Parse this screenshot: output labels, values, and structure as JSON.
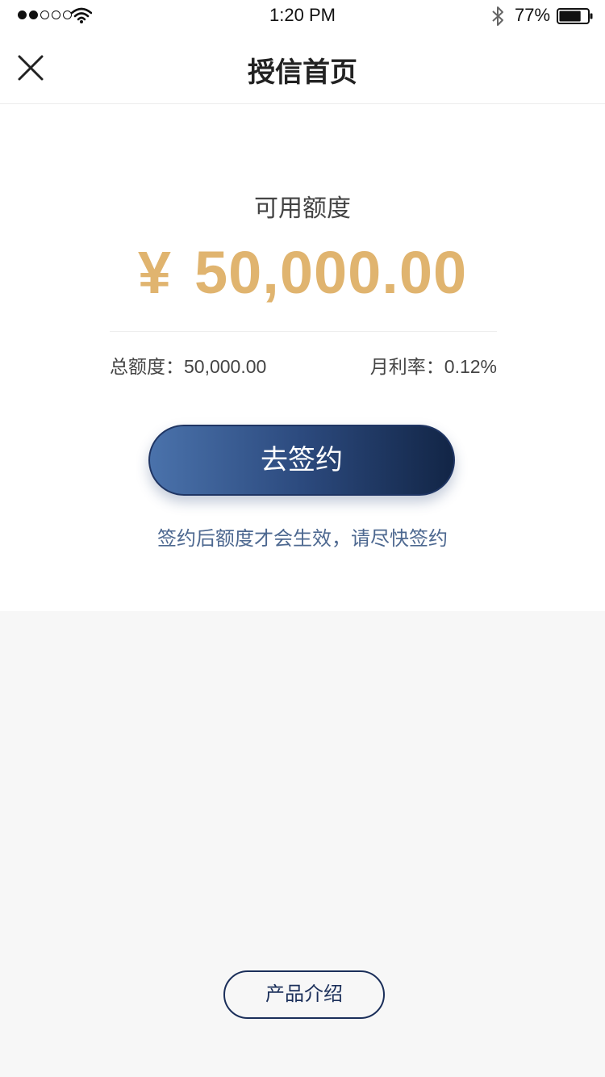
{
  "status_bar": {
    "time": "1:20 PM",
    "battery_percent": "77%",
    "battery_level": 0.77,
    "signal_strength": 2,
    "signal_total": 5
  },
  "nav": {
    "title": "授信首页",
    "close_icon": "close-icon"
  },
  "credit": {
    "available_label": "可用额度",
    "currency_symbol": "¥",
    "available_amount": "50,000.00",
    "total_label": "总额度：",
    "total_value": "50,000.00",
    "rate_label": "月利率：",
    "rate_value": "0.12%",
    "accent_color": "#e0b46f"
  },
  "actions": {
    "sign_label": "去签约",
    "sign_hint": "签约后额度才会生效，请尽快签约",
    "intro_label": "产品介绍"
  }
}
